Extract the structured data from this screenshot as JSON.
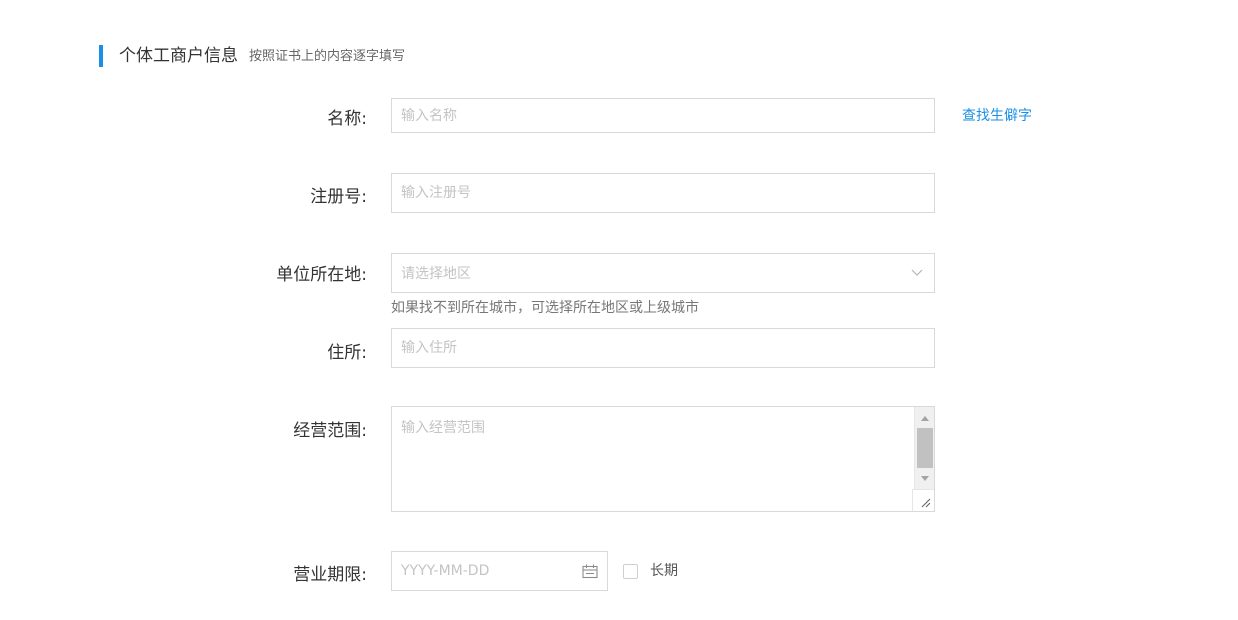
{
  "section": {
    "title": "个体工商户信息",
    "hint": "按照证书上的内容逐字填写",
    "accent_color": "#1a8fe8"
  },
  "form": {
    "name": {
      "label": "名称:",
      "placeholder": "输入名称",
      "lookup_link": "查找生僻字"
    },
    "registration_number": {
      "label": "注册号:",
      "placeholder": "输入注册号"
    },
    "location": {
      "label": "单位所在地:",
      "placeholder": "请选择地区",
      "icon": "chevron-down-icon",
      "hint": "如果找不到所在城市，可选择所在地区或上级城市"
    },
    "address": {
      "label": "住所:",
      "placeholder": "输入住所"
    },
    "business_scope": {
      "label": "经营范围:",
      "placeholder": "输入经营范围"
    },
    "business_term": {
      "label": "营业期限:",
      "placeholder": "YYYY-MM-DD",
      "icon": "calendar-icon",
      "long_term_label": "长期",
      "long_term_checked": false
    }
  }
}
